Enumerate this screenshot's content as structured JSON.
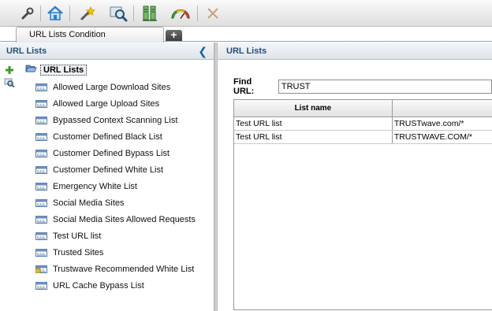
{
  "toolbar": {
    "icons": [
      "wrench-icon",
      "home-icon",
      "magic-wand-icon",
      "search-zoom-icon",
      "servers-icon",
      "dashboard-gauge-icon",
      "tools-disabled-icon"
    ]
  },
  "tabs": [
    {
      "label": "URL Lists Condition"
    }
  ],
  "left_panel": {
    "title": "URL Lists",
    "tree": {
      "root_label": "URL Lists",
      "items": [
        {
          "label": "Allowed Large Download Sites",
          "icon": "list-icon"
        },
        {
          "label": "Allowed Large Upload Sites",
          "icon": "list-icon"
        },
        {
          "label": "Bypassed Context Scanning List",
          "icon": "list-icon"
        },
        {
          "label": "Customer Defined Black List",
          "icon": "list-icon"
        },
        {
          "label": "Customer Defined Bypass List",
          "icon": "list-icon"
        },
        {
          "label": "Customer Defined White List",
          "icon": "list-icon"
        },
        {
          "label": "Emergency White List",
          "icon": "list-icon"
        },
        {
          "label": "Social Media Sites",
          "icon": "list-icon"
        },
        {
          "label": "Social Media Sites Allowed Requests",
          "icon": "list-icon"
        },
        {
          "label": "Test URL list",
          "icon": "list-icon"
        },
        {
          "label": "Trusted Sites",
          "icon": "list-icon"
        },
        {
          "label": "Trustwave Recommended White List",
          "icon": "locked-list-icon"
        },
        {
          "label": "URL Cache Bypass List",
          "icon": "list-icon"
        }
      ]
    }
  },
  "right_panel": {
    "title": "URL Lists",
    "find": {
      "label": "Find URL:",
      "value": "TRUST"
    },
    "table": {
      "columns": [
        "List name",
        ""
      ],
      "rows": [
        [
          "Test URL list",
          "TRUSTwave.com/*"
        ],
        [
          "Test URL list",
          "TRUSTWAVE.COM/*"
        ]
      ]
    }
  },
  "colors": {
    "header_text": "#1f4f7a",
    "accent": "#1b62a8"
  }
}
